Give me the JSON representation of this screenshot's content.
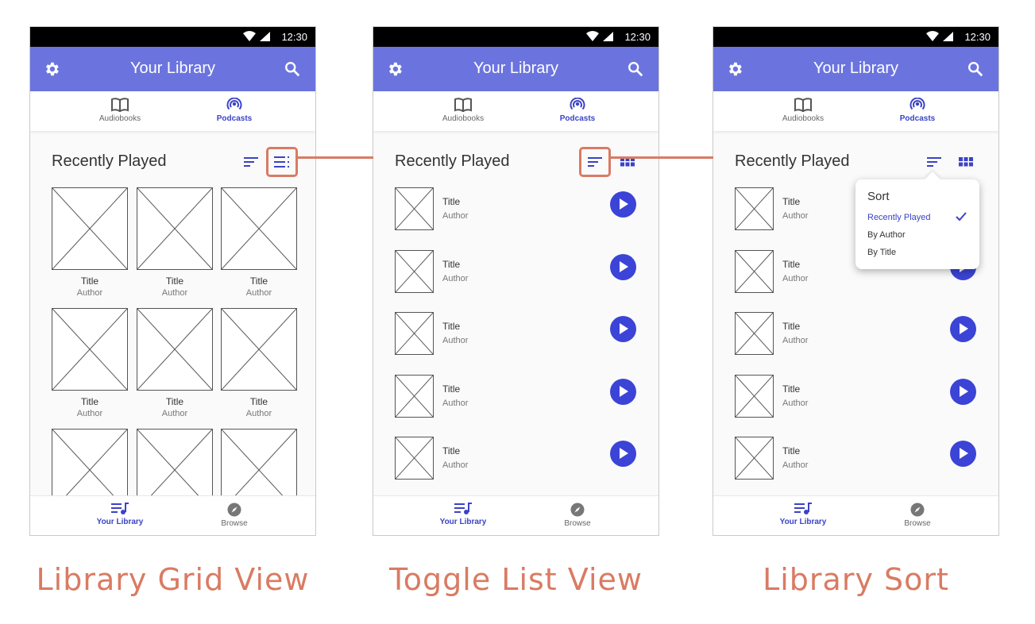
{
  "status": {
    "time": "12:30"
  },
  "app": {
    "title": "Your Library"
  },
  "tabs": {
    "audiobooks": "Audiobooks",
    "podcasts": "Podcasts"
  },
  "section": {
    "title": "Recently Played"
  },
  "item": {
    "title": "Title",
    "author": "Author"
  },
  "nav": {
    "library": "Your Library",
    "browse": "Browse"
  },
  "sort_menu": {
    "title": "Sort",
    "options": [
      "Recently Played",
      "By Author",
      "By Title"
    ],
    "selected": "Recently Played"
  },
  "captions": {
    "grid": "Library Grid View",
    "list": "Toggle List View",
    "sort": "Library Sort"
  },
  "colors": {
    "appbar": "#6b74de",
    "accent": "#3b44d6",
    "annotation": "#d97b63"
  },
  "icons": [
    "gear-icon",
    "search-icon",
    "book-icon",
    "podcast-icon",
    "sort-icon",
    "list-view-icon",
    "grid-view-icon",
    "play-icon",
    "playlist-icon",
    "compass-icon",
    "check-icon"
  ]
}
